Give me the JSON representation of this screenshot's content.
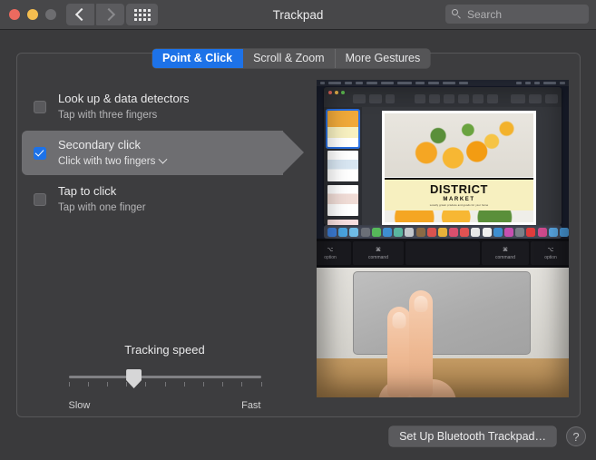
{
  "window": {
    "title": "Trackpad",
    "traffic_lights": [
      "close",
      "minimize",
      "zoom"
    ],
    "nav_back_icon": "chevron-left-icon",
    "nav_forward_icon": "chevron-right-icon",
    "grid_icon": "show-all-preferences-icon",
    "search": {
      "placeholder": "Search",
      "value": "",
      "icon": "search-icon"
    }
  },
  "tabs": [
    {
      "label": "Point & Click",
      "active": true
    },
    {
      "label": "Scroll & Zoom",
      "active": false
    },
    {
      "label": "More Gestures",
      "active": false
    }
  ],
  "options": [
    {
      "title": "Look up & data detectors",
      "subtitle": "Tap with three fingers",
      "checked": false,
      "selected": false,
      "has_dropdown": false
    },
    {
      "title": "Secondary click",
      "subtitle": "Click with two fingers",
      "checked": true,
      "selected": true,
      "has_dropdown": true
    },
    {
      "title": "Tap to click",
      "subtitle": "Tap with one finger",
      "checked": false,
      "selected": false,
      "has_dropdown": false
    }
  ],
  "slider": {
    "label": "Tracking speed",
    "min_label": "Slow",
    "max_label": "Fast",
    "value_percent": 34,
    "tick_count": 10
  },
  "preview": {
    "poster_title": "DISTRICT",
    "poster_subtitle": "MARKET",
    "poster_tagline": "Locally grown produce and goods for your home",
    "key_left_option": "option",
    "key_left_command": "command",
    "key_right_command": "command",
    "key_right_option": "option",
    "key_glyph_option": "⌥",
    "key_glyph_command": "⌘"
  },
  "footer": {
    "setup_button": "Set Up Bluetooth Trackpad…",
    "help_button": "?"
  },
  "colors": {
    "accent": "#1d72e8",
    "window_bg": "#3a3a3c",
    "titlebar_bg": "#474749",
    "highlight_row": "#6e6e71",
    "text_primary": "#eaeaeb",
    "text_secondary": "#b5b5b7"
  }
}
